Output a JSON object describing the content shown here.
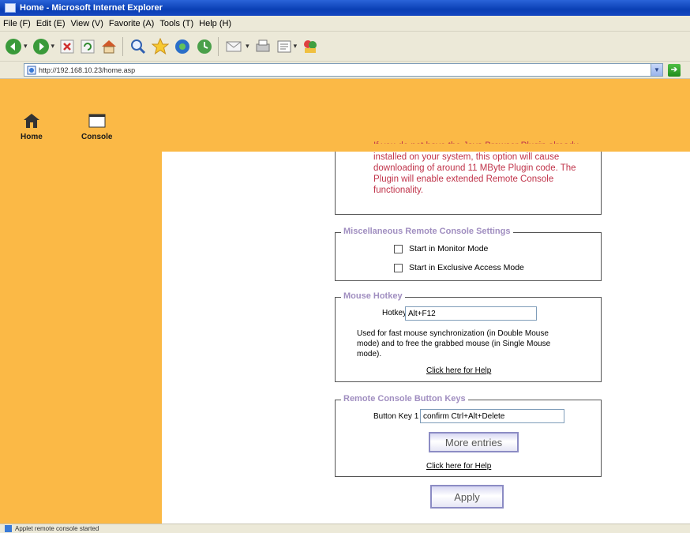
{
  "window": {
    "title": "Home - Microsoft Internet Explorer"
  },
  "menu": [
    "File (F)",
    "Edit (E)",
    "View (V)",
    "Favorite (A)",
    "Tools (T)",
    "Help (H)"
  ],
  "toolbar": {
    "icons": [
      "back-icon",
      "forward-icon",
      "stop-icon",
      "refresh-icon",
      "home-icon",
      "search-icon",
      "favorites-icon",
      "media-icon",
      "history-icon",
      "mail-icon",
      "print-icon",
      "edit-icon",
      "messenger-icon"
    ]
  },
  "address": {
    "url": "http://192.168.10.23/home.asp"
  },
  "nav": {
    "home_label": "Home",
    "console_label": "Console"
  },
  "plugin_info": {
    "text": "If you do not have the Java Browser Plugin already installed on your system, this option will cause downloading of around 11 MByte Plugin code. The Plugin will enable extended Remote Console functionality."
  },
  "misc_settings": {
    "legend": "Miscellaneous Remote Console Settings",
    "options": [
      {
        "label": "Start in Monitor Mode",
        "checked": false
      },
      {
        "label": "Start in Exclusive Access Mode",
        "checked": false
      }
    ]
  },
  "mouse_hotkey": {
    "legend": "Mouse Hotkey",
    "label": "Hotkey",
    "value": "Alt+F12",
    "help": "Used for fast mouse synchronization (in Double Mouse mode) and to free the grabbed mouse (in Single Mouse mode).",
    "help_link": "Click here for Help"
  },
  "button_keys": {
    "legend": "Remote Console Button Keys",
    "label": "Button Key 1",
    "value": "confirm Ctrl+Alt+Delete",
    "more_label": "More entries",
    "help_link": "Click here for Help"
  },
  "apply_label": "Apply",
  "status": {
    "text": "Applet remote console started"
  },
  "colors": {
    "sidebar": "#fbb946",
    "legend_text": "#a08ec0",
    "info_text": "#c0344a",
    "titlebar": "#0a3fb4"
  }
}
